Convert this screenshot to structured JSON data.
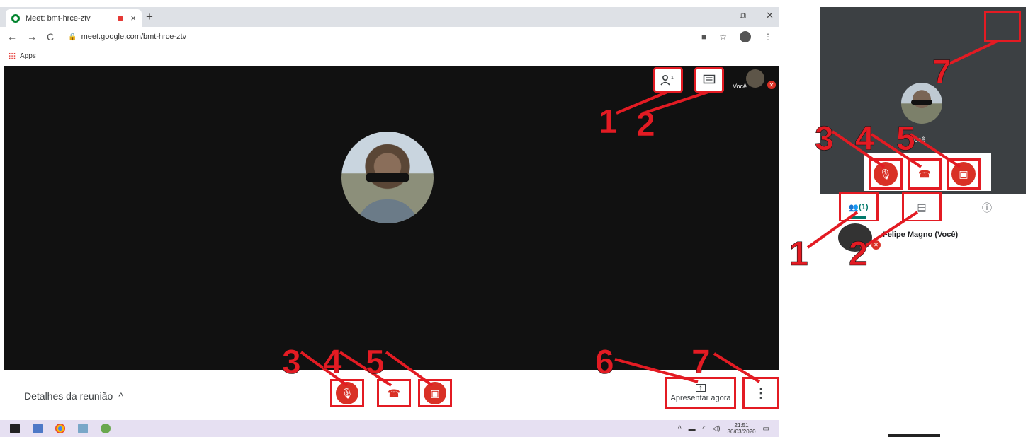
{
  "browser": {
    "tab_title": "Meet: bmt-hrce-ztv",
    "tab_close": "×",
    "new_tab": "+",
    "window_controls": [
      "–",
      "⧉",
      "✕"
    ],
    "url": "meet.google.com/bmt-hrce-ztv",
    "bookmarks_label": "Apps"
  },
  "meeting": {
    "self_label": "Você",
    "details_label": "Detalhes da reunião",
    "present_label": "Apresentar agora",
    "more_glyph": "⋮",
    "people_count": "1"
  },
  "side_panel": {
    "self_label": "Você",
    "people_tab": "(1)",
    "participant_name": "Felipe Magno (Você)"
  },
  "taskbar": {
    "time": "21:51",
    "date": "30/03/2020"
  },
  "annotations": [
    "1",
    "2",
    "3",
    "4",
    "5",
    "6",
    "7"
  ],
  "colors": {
    "highlight": "#e31b23",
    "meet_red": "#d93025",
    "stage": "#111111"
  }
}
